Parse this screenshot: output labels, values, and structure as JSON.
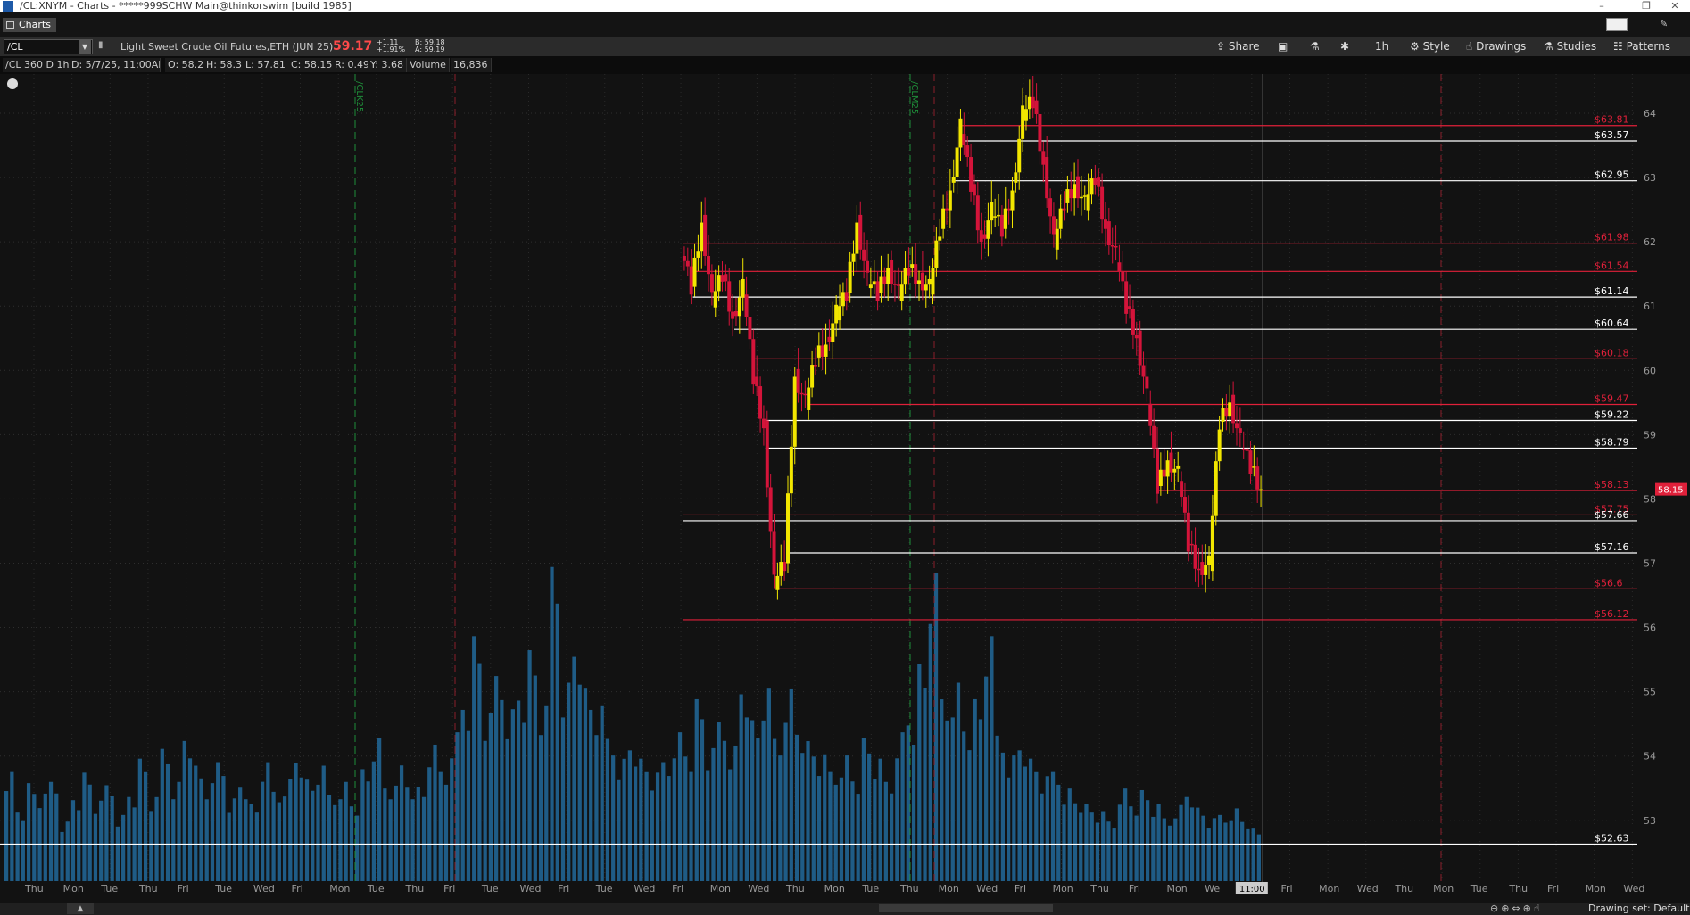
{
  "window": {
    "title": "/CL:XNYM - Charts - *****999SCHW Main@thinkorswim [build 1985]"
  },
  "tab": {
    "label": "Charts"
  },
  "toolbar": {
    "symbol": "/CL",
    "description": "Light Sweet Crude Oil Futures,ETH (JUN 25)",
    "last": "59.17",
    "change": "+1.11",
    "change_pct": "+1.91%",
    "bid": "B: 59.18",
    "ask": "A: 59.19",
    "share": "Share",
    "timeframe": "1h",
    "style": "Style",
    "drawings": "Drawings",
    "studies": "Studies",
    "patterns": "Patterns"
  },
  "infobar": {
    "spec": "/CL 360 D 1h",
    "date": "D: 5/7/25, 11:00AM",
    "open": "O: 58.2",
    "high": "H: 58.3",
    "low": "L: 57.81",
    "close": "C: 58.15",
    "range": "R: 0.49",
    "y": "Y: 3.68",
    "volume_label": "Volume",
    "volume_value": "16,836"
  },
  "chart_data": {
    "type": "line",
    "y_axis": {
      "ticks": [
        64,
        63,
        62,
        61,
        60,
        59,
        58,
        57,
        56,
        55,
        54,
        53
      ],
      "range": [
        52.4,
        64.5
      ]
    },
    "current_price": "58.15",
    "price_levels": [
      {
        "label": "$63.81",
        "value": 63.81,
        "color": "#e0203a"
      },
      {
        "label": "$63.57",
        "value": 63.57,
        "color": "#ffffff"
      },
      {
        "label": "$62.95",
        "value": 62.95,
        "color": "#ffffff"
      },
      {
        "label": "$61.98",
        "value": 61.98,
        "color": "#e0203a"
      },
      {
        "label": "$61.54",
        "value": 61.54,
        "color": "#e0203a"
      },
      {
        "label": "$61.14",
        "value": 61.14,
        "color": "#ffffff"
      },
      {
        "label": "$60.64",
        "value": 60.64,
        "color": "#ffffff"
      },
      {
        "label": "$60.18",
        "value": 60.18,
        "color": "#e0203a"
      },
      {
        "label": "$59.47",
        "value": 59.47,
        "color": "#e0203a"
      },
      {
        "label": "$59.22",
        "value": 59.22,
        "color": "#ffffff"
      },
      {
        "label": "$58.79",
        "value": 58.79,
        "color": "#ffffff"
      },
      {
        "label": "$58.13",
        "value": 58.13,
        "color": "#e0203a"
      },
      {
        "label": "$57.75",
        "value": 57.75,
        "color": "#e0203a"
      },
      {
        "label": "$57.66",
        "value": 57.66,
        "color": "#ffffff"
      },
      {
        "label": "$57.16",
        "value": 57.16,
        "color": "#ffffff"
      },
      {
        "label": "$56.6",
        "value": 56.6,
        "color": "#e0203a"
      },
      {
        "label": "$56.12",
        "value": 56.12,
        "color": "#e0203a"
      },
      {
        "label": "$52.63",
        "value": 52.63,
        "color": "#ffffff"
      }
    ],
    "x_labels": [
      "Thu",
      "Mon",
      "Tue",
      "Thu",
      "Fri",
      "Tue",
      "Wed",
      "Fri",
      "Mon",
      "Tue",
      "Thu",
      "Fri",
      "Tue",
      "Wed",
      "Fri",
      "Tue",
      "Wed",
      "Fri",
      "Mon",
      "Wed",
      "Thu",
      "Mon",
      "Tue",
      "Thu",
      "Mon",
      "Wed",
      "Fri",
      "Mon",
      "Thu",
      "Fri",
      "Mon",
      "We",
      "11:00",
      "Fri",
      "Mon",
      "Wed",
      "Thu",
      "Mon",
      "Tue",
      "Thu",
      "Fri",
      "Mon",
      "Wed"
    ],
    "contract_markers": [
      "/CLK25",
      "/CLM25"
    ],
    "price_path": [
      [
        0,
        61.9
      ],
      [
        2,
        61.3
      ],
      [
        4,
        62.3
      ],
      [
        6,
        61.1
      ],
      [
        8,
        61.5
      ],
      [
        10,
        60.8
      ],
      [
        12,
        61.3
      ],
      [
        14,
        59.9
      ],
      [
        16,
        59.1
      ],
      [
        18,
        56.7
      ],
      [
        20,
        57.0
      ],
      [
        22,
        59.9
      ],
      [
        24,
        59.5
      ],
      [
        26,
        60.2
      ],
      [
        28,
        60.4
      ],
      [
        30,
        60.9
      ],
      [
        32,
        61.2
      ],
      [
        34,
        62.3
      ],
      [
        36,
        61.4
      ],
      [
        38,
        61.2
      ],
      [
        40,
        61.6
      ],
      [
        42,
        61.2
      ],
      [
        44,
        61.6
      ],
      [
        46,
        61.4
      ],
      [
        48,
        61.3
      ],
      [
        50,
        62.2
      ],
      [
        52,
        62.8
      ],
      [
        54,
        63.8
      ],
      [
        56,
        62.9
      ],
      [
        58,
        62.0
      ],
      [
        60,
        62.5
      ],
      [
        62,
        62.2
      ],
      [
        64,
        62.8
      ],
      [
        66,
        64.0
      ],
      [
        68,
        64.2
      ],
      [
        70,
        63.2
      ],
      [
        72,
        62.0
      ],
      [
        74,
        62.6
      ],
      [
        76,
        62.9
      ],
      [
        78,
        62.6
      ],
      [
        80,
        63.0
      ],
      [
        82,
        62.2
      ],
      [
        84,
        61.8
      ],
      [
        86,
        61.0
      ],
      [
        88,
        60.5
      ],
      [
        90,
        59.6
      ],
      [
        92,
        58.2
      ],
      [
        94,
        58.6
      ],
      [
        96,
        58.4
      ],
      [
        98,
        57.3
      ],
      [
        100,
        56.9
      ],
      [
        102,
        57.0
      ],
      [
        104,
        59.2
      ],
      [
        106,
        59.5
      ],
      [
        108,
        58.9
      ],
      [
        110,
        58.5
      ],
      [
        112,
        58.15
      ]
    ],
    "volume_series": [
      0.33,
      0.22,
      0.28,
      0.25,
      0.3,
      0.18,
      0.26,
      0.31,
      0.23,
      0.29,
      0.2,
      0.27,
      0.35,
      0.24,
      0.4,
      0.3,
      0.45,
      0.33,
      0.28,
      0.36,
      0.25,
      0.3,
      0.22,
      0.34,
      0.27,
      0.31,
      0.38,
      0.29,
      0.33,
      0.26,
      0.3,
      0.24,
      0.32,
      0.41,
      0.28,
      0.35,
      0.3,
      0.27,
      0.39,
      0.33,
      0.45,
      0.55,
      0.7,
      0.48,
      0.62,
      0.52,
      0.58,
      0.66,
      0.5,
      0.95,
      0.6,
      0.72,
      0.55,
      0.5,
      0.43,
      0.37,
      0.42,
      0.35,
      0.31,
      0.36,
      0.45,
      0.4,
      0.52,
      0.38,
      0.48,
      0.41,
      0.6,
      0.46,
      0.55,
      0.43,
      0.58,
      0.47,
      0.4,
      0.36,
      0.33,
      0.38,
      0.32,
      0.41,
      0.35,
      0.3,
      0.45,
      0.5,
      0.62,
      0.88,
      0.55,
      0.6,
      0.48,
      0.52,
      0.7,
      0.44,
      0.38,
      0.42,
      0.35,
      0.3,
      0.33,
      0.28,
      0.25,
      0.22,
      0.2,
      0.18,
      0.28,
      0.24,
      0.26,
      0.22,
      0.19,
      0.23,
      0.27,
      0.21,
      0.18,
      0.2,
      0.22,
      0.19,
      0.15
    ]
  },
  "status": {
    "drawing_set": "Drawing set: Default",
    "price_marker": "58.15"
  }
}
